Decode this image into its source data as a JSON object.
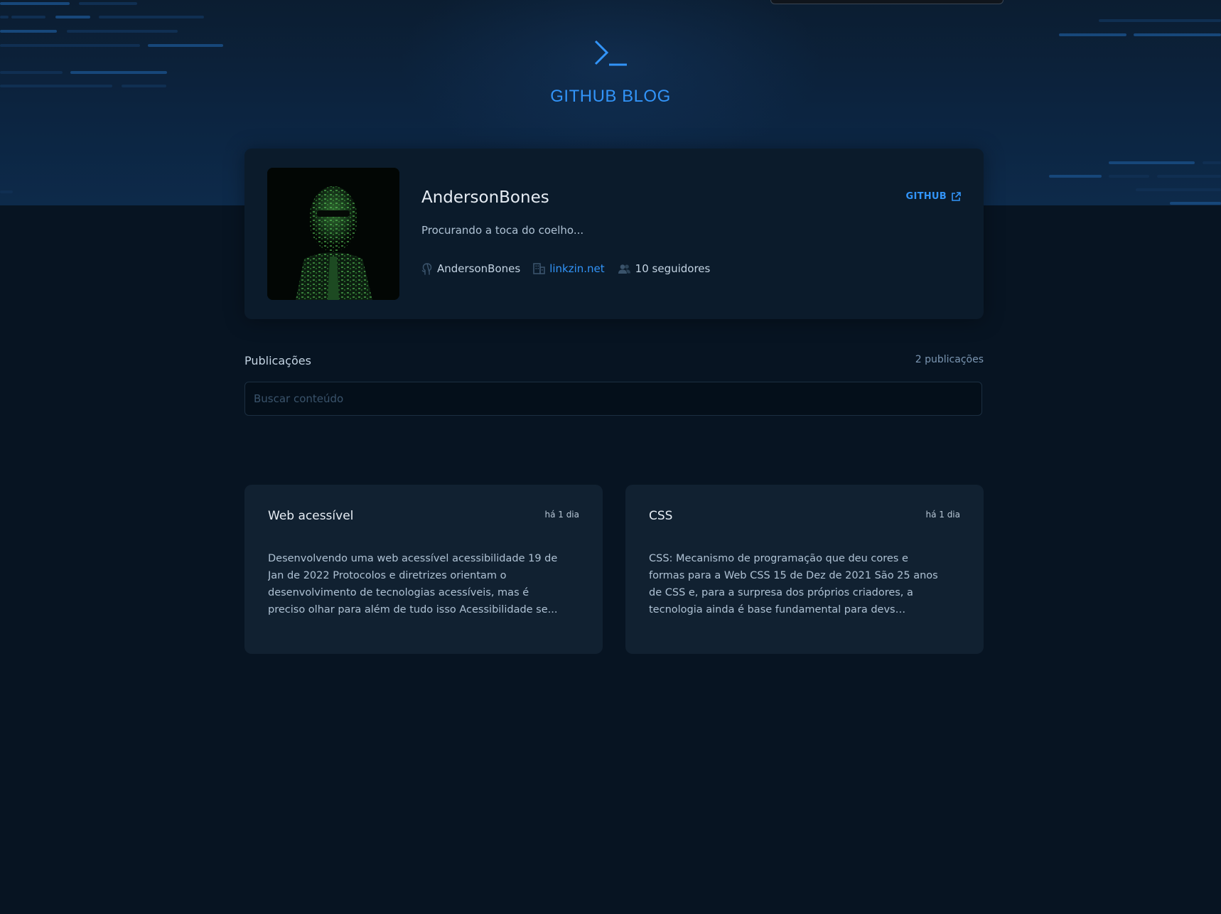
{
  "header": {
    "logo_icon": "terminal-prompt-icon",
    "title": "GITHUB BLOG"
  },
  "profile": {
    "name": "AndersonBones",
    "bio": "Procurando a toca do coelho...",
    "github_label": "GITHUB",
    "github_icon": "external-link-icon",
    "login": "AndersonBones",
    "company": "linkzin.net",
    "followers": "10 seguidores"
  },
  "publications": {
    "title": "Publicações",
    "count": "2 publicações",
    "search_placeholder": "Buscar conteúdo"
  },
  "posts": [
    {
      "title": "Web acessível",
      "date": "há 1 dia",
      "excerpt": "Desenvolvendo uma web acessível acessibilidade 19 de Jan de 2022 Protocolos e diretrizes orientam o desenvolvimento de tecnologias acessíveis, mas é preciso olhar para além de tudo isso Acessibilidade se..."
    },
    {
      "title": "CSS",
      "date": "há 1 dia",
      "excerpt": "CSS: Mecanismo de programação que deu cores e formas para a Web CSS 15 de Dez de 2021 São 25 anos de CSS e, para a surpresa dos próprios criadores, a tecnologia ainda é base fundamental para devs novato..."
    }
  ],
  "colors": {
    "accent": "#3294f8",
    "background": "#071422",
    "card": "#112131",
    "profile_card": "#0b1b2b"
  }
}
